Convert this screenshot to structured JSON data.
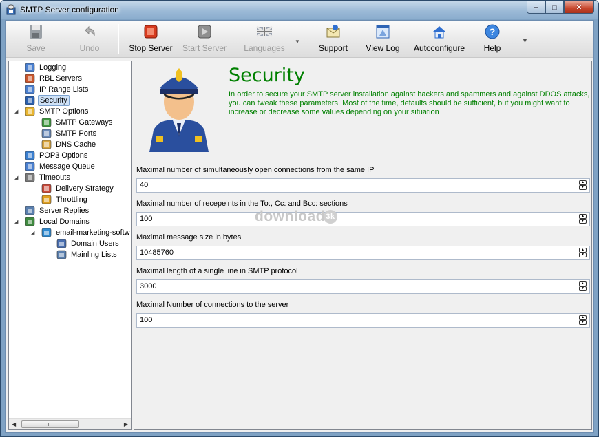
{
  "window": {
    "title": "SMTP Server configuration"
  },
  "window_buttons": {
    "minimize": "–",
    "maximize": "□",
    "close": "✕"
  },
  "toolbar": {
    "save": "Save",
    "undo": "Undo",
    "stop_server": "Stop Server",
    "start_server": "Start Server",
    "languages": "Languages",
    "support": "Support",
    "view_log": "View Log",
    "autoconfigure": "Autoconfigure",
    "help": "Help"
  },
  "tree": {
    "items": [
      {
        "label": "Logging",
        "icon": "logging-icon"
      },
      {
        "label": "RBL Servers",
        "icon": "rbl-icon"
      },
      {
        "label": "IP Range Lists",
        "icon": "ip-range-icon"
      },
      {
        "label": "Security",
        "icon": "security-icon",
        "selected": true
      },
      {
        "label": "SMTP Options",
        "icon": "smtp-options-icon"
      },
      {
        "label": "SMTP Gateways",
        "icon": "gateways-icon"
      },
      {
        "label": "SMTP Ports",
        "icon": "ports-icon"
      },
      {
        "label": "DNS Cache",
        "icon": "dns-cache-icon"
      },
      {
        "label": "POP3 Options",
        "icon": "pop3-icon"
      },
      {
        "label": "Message Queue",
        "icon": "queue-icon"
      },
      {
        "label": "Timeouts",
        "icon": "timeouts-icon"
      },
      {
        "label": "Delivery Strategy",
        "icon": "calendar-icon"
      },
      {
        "label": "Throttling",
        "icon": "traffic-light-icon"
      },
      {
        "label": "Server Replies",
        "icon": "server-replies-icon"
      },
      {
        "label": "Local Domains",
        "icon": "local-domains-icon"
      },
      {
        "label": "email-marketing-softw",
        "icon": "globe-icon"
      },
      {
        "label": "Domain Users",
        "icon": "users-icon"
      },
      {
        "label": "Mainling Lists",
        "icon": "mailing-lists-icon"
      }
    ]
  },
  "header": {
    "title": "Security",
    "description": "In order to secure your SMTP server installation against hackers and spammers and against DDOS attacks, you can tweak these parameters. Most of the time, defaults should be sufficient, but you might want to increase or decrease some values depending on your situation"
  },
  "fields": [
    {
      "label": "Maximal number of simultaneously open connections from the same IP",
      "value": "40"
    },
    {
      "label": "Maximal number of recepeints in the To:, Cc: and Bcc: sections",
      "value": "100"
    },
    {
      "label": "Maximal message size in bytes",
      "value": "10485760"
    },
    {
      "label": "Maximal length of a single line in SMTP protocol",
      "value": "3000"
    },
    {
      "label": "Maximal Number of connections to the server",
      "value": "100"
    }
  ],
  "watermark": {
    "text": "download",
    "badge": "3k"
  }
}
